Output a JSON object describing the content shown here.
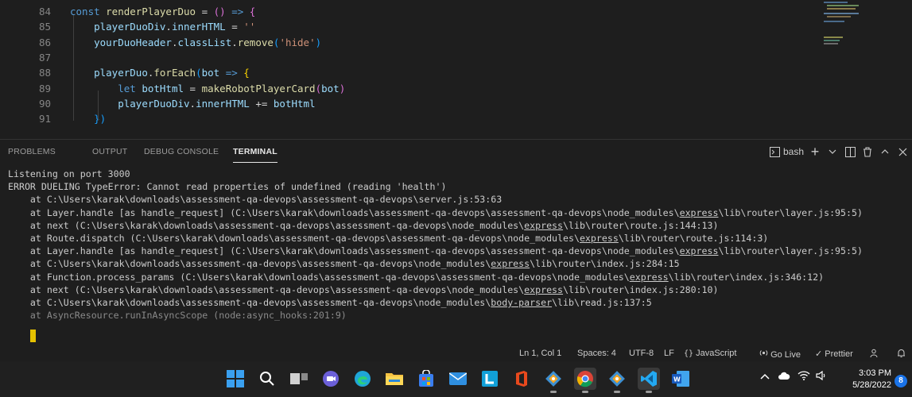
{
  "editor": {
    "lines": [
      {
        "n": "84",
        "segs": [
          {
            "t": "const ",
            "c": "#569cd6"
          },
          {
            "t": "renderPlayerDuo",
            "c": "#dcdcaa"
          },
          {
            "t": " = ",
            "c": "#d4d4d4"
          },
          {
            "t": "()",
            "c": "#da70d6"
          },
          {
            "t": " => ",
            "c": "#569cd6"
          },
          {
            "t": "{",
            "c": "#da70d6"
          }
        ]
      },
      {
        "n": "85",
        "segs": [
          {
            "t": "    ",
            "c": "#d4d4d4"
          },
          {
            "t": "playerDuoDiv",
            "c": "#9cdcfe"
          },
          {
            "t": ".",
            "c": "#d4d4d4"
          },
          {
            "t": "innerHTML",
            "c": "#9cdcfe"
          },
          {
            "t": " = ",
            "c": "#d4d4d4"
          },
          {
            "t": "''",
            "c": "#ce9178"
          }
        ]
      },
      {
        "n": "86",
        "segs": [
          {
            "t": "    ",
            "c": "#d4d4d4"
          },
          {
            "t": "yourDuoHeader",
            "c": "#9cdcfe"
          },
          {
            "t": ".",
            "c": "#d4d4d4"
          },
          {
            "t": "classList",
            "c": "#9cdcfe"
          },
          {
            "t": ".",
            "c": "#d4d4d4"
          },
          {
            "t": "remove",
            "c": "#dcdcaa"
          },
          {
            "t": "(",
            "c": "#179fff"
          },
          {
            "t": "'hide'",
            "c": "#ce9178"
          },
          {
            "t": ")",
            "c": "#179fff"
          }
        ]
      },
      {
        "n": "87",
        "segs": []
      },
      {
        "n": "88",
        "segs": [
          {
            "t": "    ",
            "c": "#d4d4d4"
          },
          {
            "t": "playerDuo",
            "c": "#9cdcfe"
          },
          {
            "t": ".",
            "c": "#d4d4d4"
          },
          {
            "t": "forEach",
            "c": "#dcdcaa"
          },
          {
            "t": "(",
            "c": "#179fff"
          },
          {
            "t": "bot",
            "c": "#9cdcfe"
          },
          {
            "t": " => ",
            "c": "#569cd6"
          },
          {
            "t": "{",
            "c": "#ffd700"
          }
        ]
      },
      {
        "n": "89",
        "segs": [
          {
            "t": "        ",
            "c": "#d4d4d4"
          },
          {
            "t": "let ",
            "c": "#569cd6"
          },
          {
            "t": "botHtml",
            "c": "#9cdcfe"
          },
          {
            "t": " = ",
            "c": "#d4d4d4"
          },
          {
            "t": "makeRobotPlayerCard",
            "c": "#dcdcaa"
          },
          {
            "t": "(",
            "c": "#da70d6"
          },
          {
            "t": "bot",
            "c": "#9cdcfe"
          },
          {
            "t": ")",
            "c": "#da70d6"
          }
        ]
      },
      {
        "n": "90",
        "segs": [
          {
            "t": "        ",
            "c": "#d4d4d4"
          },
          {
            "t": "playerDuoDiv",
            "c": "#9cdcfe"
          },
          {
            "t": ".",
            "c": "#d4d4d4"
          },
          {
            "t": "innerHTML",
            "c": "#9cdcfe"
          },
          {
            "t": " += ",
            "c": "#d4d4d4"
          },
          {
            "t": "botHtml",
            "c": "#9cdcfe"
          }
        ]
      },
      {
        "n": "91",
        "segs": [
          {
            "t": "    ",
            "c": "#d4d4d4"
          },
          {
            "t": "})",
            "c": "#179fff"
          }
        ]
      }
    ]
  },
  "panel": {
    "tabs": [
      "PROBLEMS",
      "OUTPUT",
      "DEBUG CONSOLE",
      "TERMINAL"
    ],
    "active_tab": "TERMINAL",
    "shell": "bash",
    "actions": {
      "new": "+",
      "split": "◫",
      "trash": "🗑",
      "maximize": "^",
      "close": "×"
    }
  },
  "terminal": {
    "lines": [
      [
        {
          "t": "Listening on port 3000"
        }
      ],
      [
        {
          "t": "ERROR DUELING TypeError: Cannot read properties of undefined (reading 'health')"
        }
      ],
      [
        {
          "t": "    at C:\\Users\\karak\\downloads\\assessment-qa-devops\\assessment-qa-devops\\server.js:53:63"
        }
      ],
      [
        {
          "t": "    at Layer.handle [as handle_request] (C:\\Users\\karak\\downloads\\assessment-qa-devops\\assessment-qa-devops\\node_modules\\"
        },
        {
          "t": "express",
          "u": true
        },
        {
          "t": "\\lib\\router\\layer.js:95:5)"
        }
      ],
      [
        {
          "t": "    at next (C:\\Users\\karak\\downloads\\assessment-qa-devops\\assessment-qa-devops\\node_modules\\"
        },
        {
          "t": "express",
          "u": true
        },
        {
          "t": "\\lib\\router\\route.js:144:13)"
        }
      ],
      [
        {
          "t": "    at Route.dispatch (C:\\Users\\karak\\downloads\\assessment-qa-devops\\assessment-qa-devops\\node_modules\\"
        },
        {
          "t": "express",
          "u": true
        },
        {
          "t": "\\lib\\router\\route.js:114:3)"
        }
      ],
      [
        {
          "t": "    at Layer.handle [as handle_request] (C:\\Users\\karak\\downloads\\assessment-qa-devops\\assessment-qa-devops\\node_modules\\"
        },
        {
          "t": "express",
          "u": true
        },
        {
          "t": "\\lib\\router\\layer.js:95:5)"
        }
      ],
      [
        {
          "t": "    at C:\\Users\\karak\\downloads\\assessment-qa-devops\\assessment-qa-devops\\node_modules\\"
        },
        {
          "t": "express",
          "u": true
        },
        {
          "t": "\\lib\\router\\index.js:284:15"
        }
      ],
      [
        {
          "t": "    at Function.process_params (C:\\Users\\karak\\downloads\\assessment-qa-devops\\assessment-qa-devops\\node_modules\\"
        },
        {
          "t": "express",
          "u": true
        },
        {
          "t": "\\lib\\router\\index.js:346:12)"
        }
      ],
      [
        {
          "t": "    at next (C:\\Users\\karak\\downloads\\assessment-qa-devops\\assessment-qa-devops\\node_modules\\"
        },
        {
          "t": "express",
          "u": true
        },
        {
          "t": "\\lib\\router\\index.js:280:10)"
        }
      ],
      [
        {
          "t": "    at C:\\Users\\karak\\downloads\\assessment-qa-devops\\assessment-qa-devops\\node_modules\\"
        },
        {
          "t": "body-parser",
          "u": true
        },
        {
          "t": "\\lib\\read.js:137:5"
        }
      ],
      [
        {
          "t": "    at AsyncResource.runInAsyncScope (node:async_hooks:201:9)",
          "dim": true
        }
      ]
    ]
  },
  "statusbar": {
    "position": "Ln 1, Col 1",
    "spaces": "Spaces: 4",
    "encoding": "UTF-8",
    "eol": "LF",
    "language": "JavaScript",
    "go_live": "Go Live",
    "prettier": "Prettier"
  },
  "taskbar": {
    "apps": [
      "windows-start",
      "search",
      "task-view",
      "chat",
      "edge",
      "file-explorer",
      "store",
      "mail",
      "app-l",
      "office",
      "git",
      "chrome",
      "git-2",
      "vscode",
      "word"
    ],
    "tray_icons": [
      "chevron-up",
      "cloud",
      "wifi",
      "speaker"
    ],
    "time": "3:03 PM",
    "date": "5/28/2022",
    "notifications": "8"
  },
  "colors": {
    "background": "#1e1e1e",
    "taskbar": "#202020",
    "cursor": "#e5c100",
    "accent": "#1a73e8"
  }
}
